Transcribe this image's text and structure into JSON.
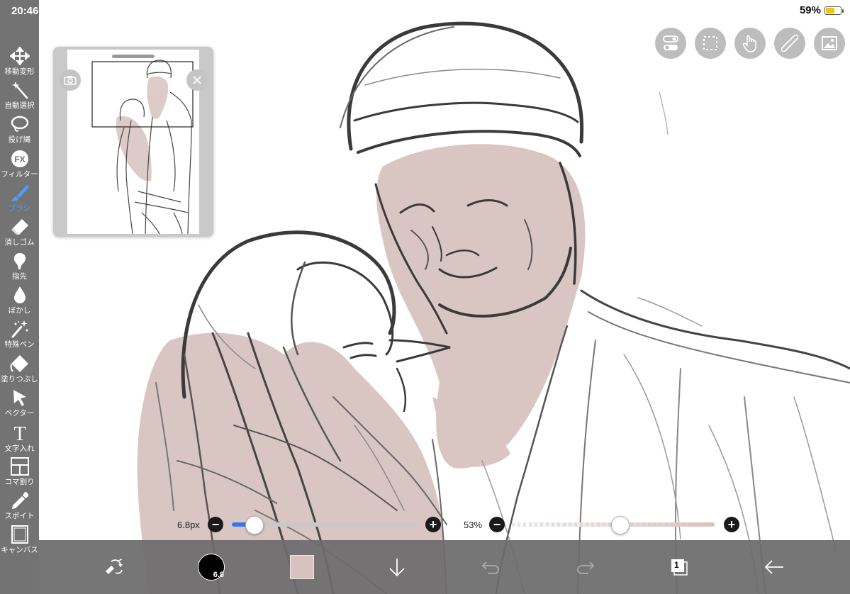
{
  "status_bar": {
    "time": "20:46",
    "battery": "59%",
    "battery_level": 0.59
  },
  "toolbar": {
    "tools": [
      {
        "label": "移動変形",
        "icon": "move-transform-icon"
      },
      {
        "label": "自動選択",
        "icon": "magic-wand-icon"
      },
      {
        "label": "投げ縄",
        "icon": "lasso-icon"
      },
      {
        "label": "フィルター",
        "icon": "fx-filter-icon"
      },
      {
        "label": "ブラシ",
        "icon": "brush-icon",
        "active": true
      },
      {
        "label": "消しゴム",
        "icon": "eraser-icon"
      },
      {
        "label": "指先",
        "icon": "finger-smudge-icon"
      },
      {
        "label": "ぼかし",
        "icon": "blur-drop-icon"
      },
      {
        "label": "特殊ペン",
        "icon": "special-pen-icon"
      },
      {
        "label": "塗りつぶし",
        "icon": "bucket-fill-icon"
      },
      {
        "label": "ベクター",
        "icon": "vector-cursor-icon"
      },
      {
        "label": "文字入れ",
        "icon": "text-icon"
      },
      {
        "label": "コマ割り",
        "icon": "frame-divide-icon"
      },
      {
        "label": "スポイト",
        "icon": "eyedropper-icon"
      },
      {
        "label": "キャンバス",
        "icon": "canvas-icon"
      }
    ]
  },
  "top_buttons": [
    "toggle-icon",
    "selection-icon",
    "gesture-icon",
    "ruler-icon",
    "image-icon"
  ],
  "brush_size": {
    "label": "6.8px",
    "value": 6.8,
    "fraction": 0.04
  },
  "opacity": {
    "label": "53%",
    "value": 53
  },
  "bottom_bar": {
    "brush_size_badge": "6.8",
    "layer_count": "1"
  },
  "colors": {
    "toolbar": "#737373",
    "accent": "#4aa0ff",
    "skin": "#d8c2bf",
    "bottom_bar": "#6c6c6c"
  }
}
